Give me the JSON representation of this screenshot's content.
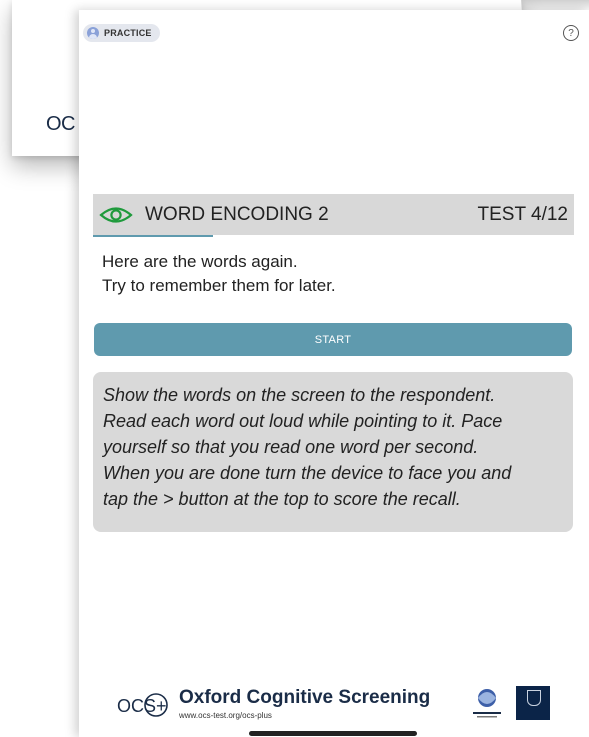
{
  "background_card": {
    "logo_text": "OC"
  },
  "header": {
    "badge_label": "PRACTICE",
    "help_symbol": "?"
  },
  "test": {
    "icon": "eye-icon",
    "title": "WORD ENCODING 2",
    "count": "TEST 4/12",
    "progress_fraction": 0.25
  },
  "instructions": {
    "line1": "Here are the words again.",
    "line2": "Try to remember them for later."
  },
  "start_button": {
    "label": "START"
  },
  "note": {
    "line1": "Show the words on the screen to the respondent.",
    "line2": "Read each word out loud while pointing to it. Pace",
    "line3": "yourself so that you read one word per second.",
    "line4": "When you are done turn the device to face you and",
    "line5": "tap the > button at the top to score the recall."
  },
  "footer": {
    "logo_text": "OCS+",
    "title": "Oxford Cognitive Screening",
    "url": "www.ocs-test.org/ocs-plus",
    "partner_logos": [
      "translational-logo",
      "oxford-logo"
    ]
  },
  "colors": {
    "accent": "#5f9aae",
    "eye_icon": "#1f9a3c",
    "header_bg": "#d8d8d8",
    "note_bg": "#d9d9d9",
    "brand_navy": "#1a2c47"
  }
}
